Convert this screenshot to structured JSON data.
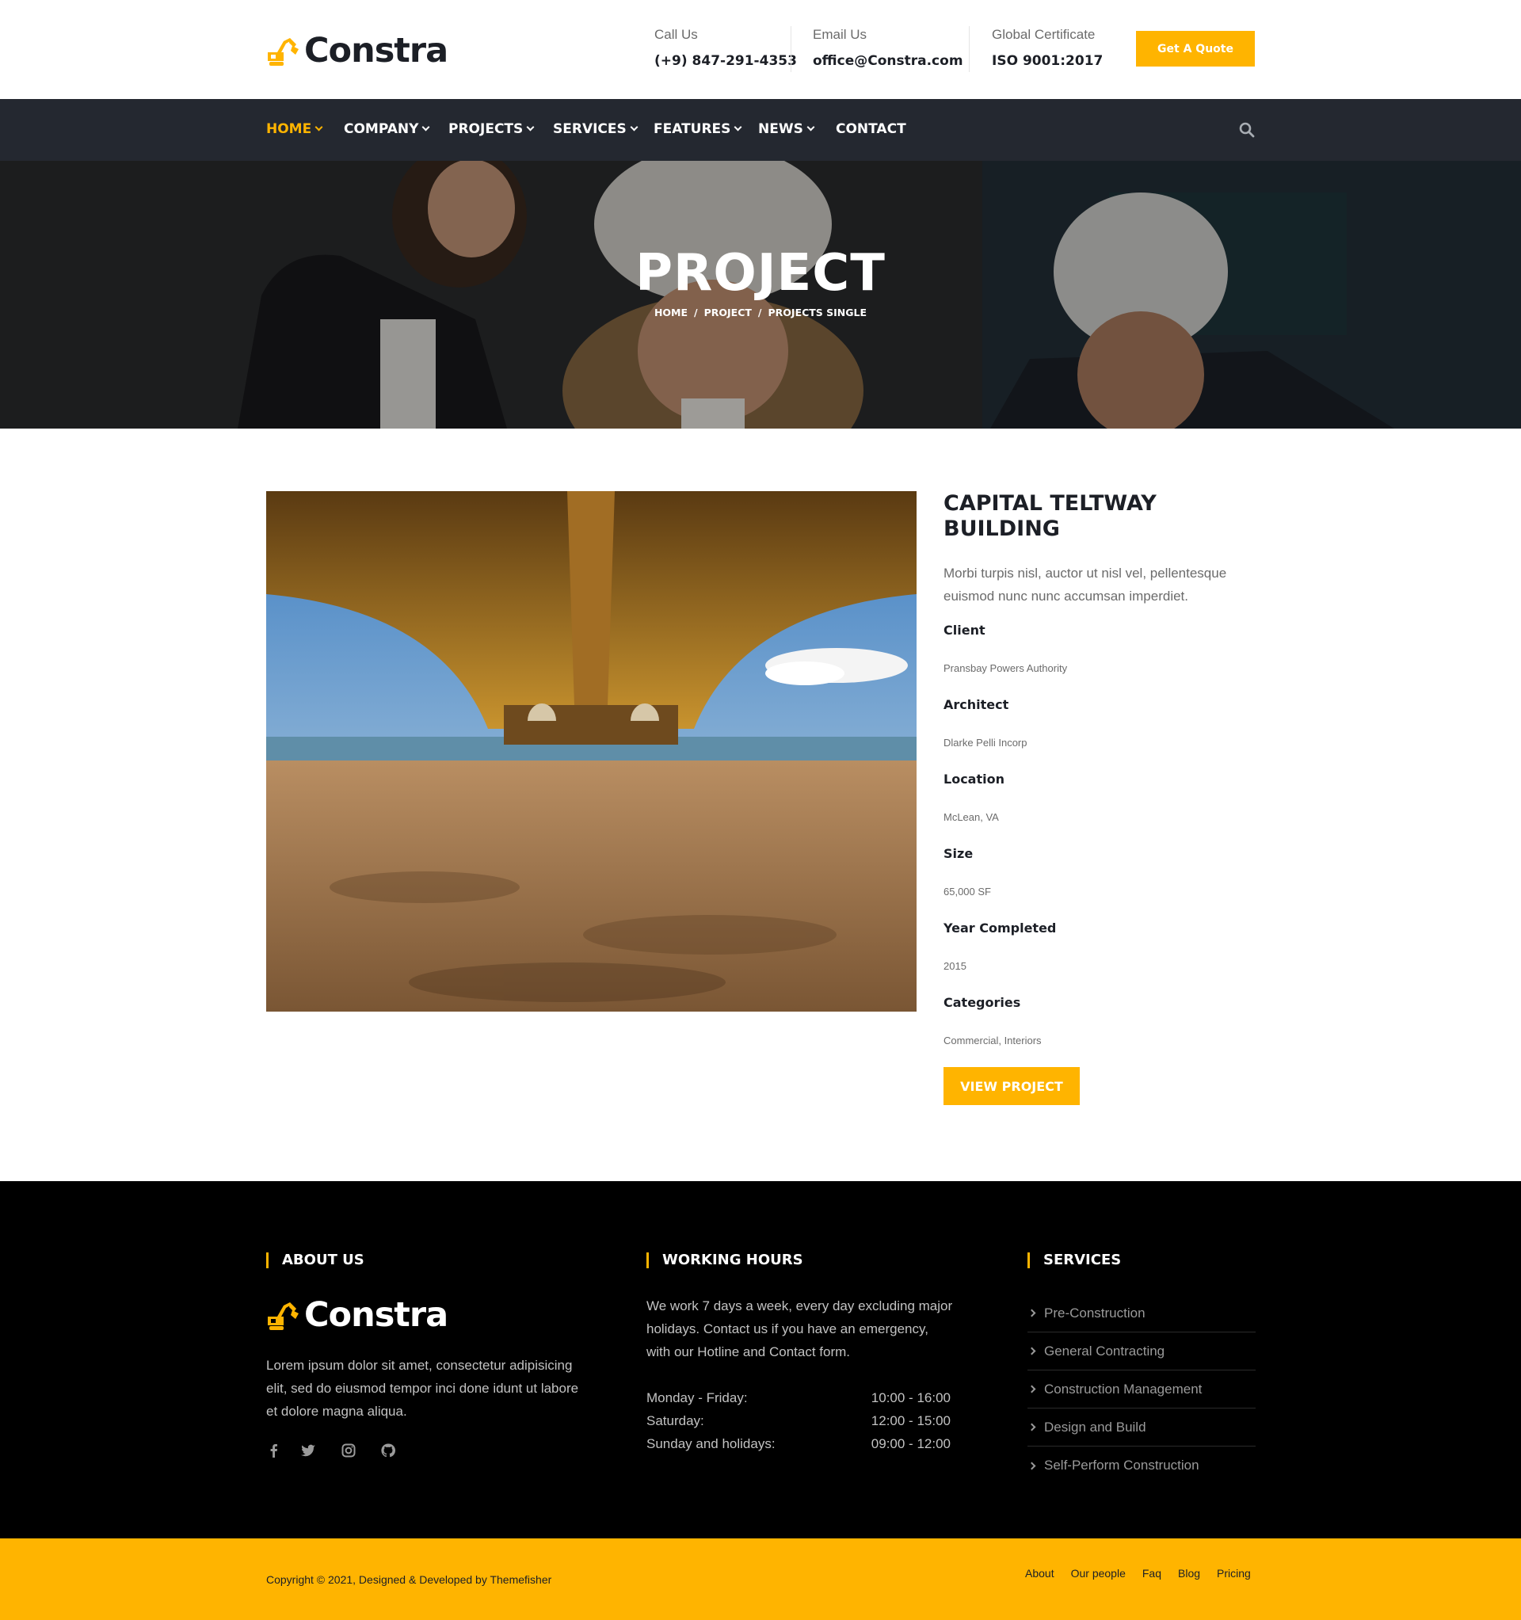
{
  "brand": {
    "name": "Constra",
    "accent": "#ffb400",
    "dark": "#242830"
  },
  "header": {
    "call": {
      "label": "Call Us",
      "value": "(+9) 847-291-4353"
    },
    "email": {
      "label": "Email Us",
      "value": "office@Constra.com"
    },
    "cert": {
      "label": "Global Certificate",
      "value": "ISO 9001:2017"
    },
    "quote_label": "Get A Quote"
  },
  "nav": {
    "items": [
      {
        "label": "HOME"
      },
      {
        "label": "COMPANY"
      },
      {
        "label": "PROJECTS"
      },
      {
        "label": "SERVICES"
      },
      {
        "label": "FEATURES"
      },
      {
        "label": "NEWS"
      },
      {
        "label": "CONTACT"
      }
    ],
    "active": "HOME",
    "search_icon": "search-icon"
  },
  "banner": {
    "title": "PROJECT",
    "breadcrumb": [
      "HOME",
      "PROJECT",
      "PROJECTS SINGLE"
    ],
    "separator": "/"
  },
  "project": {
    "title": "CAPITAL TELTWAY BUILDING",
    "description": "Morbi turpis nisl, auctor ut nisl vel, pellentesque euismod nunc nunc accumsan imperdiet.",
    "meta": [
      {
        "label": "Client",
        "value": "Pransbay Powers Authority"
      },
      {
        "label": "Architect",
        "value": "Dlarke Pelli Incorp"
      },
      {
        "label": "Location",
        "value": "McLean, VA"
      },
      {
        "label": "Size",
        "value": "65,000 SF"
      },
      {
        "label": "Year Completed",
        "value": "2015"
      },
      {
        "label": "Categories",
        "value": "Commercial, Interiors"
      }
    ],
    "button_label": "VIEW PROJECT"
  },
  "footer": {
    "about": {
      "heading": "ABOUT US",
      "text": "Lorem ipsum dolor sit amet, consectetur adipisicing elit, sed do eiusmod tempor inci done idunt ut labore et dolore magna aliqua.",
      "social": [
        "facebook-icon",
        "twitter-icon",
        "instagram-icon",
        "github-icon"
      ]
    },
    "hours": {
      "heading": "WORKING HOURS",
      "text": "We work 7 days a week, every day excluding major holidays. Contact us if you have an emergency, with our Hotline and Contact form.",
      "rows": [
        {
          "day": "Monday - Friday:",
          "time": "10:00 - 16:00"
        },
        {
          "day": "Saturday:",
          "time": "12:00 - 15:00"
        },
        {
          "day": "Sunday and holidays:",
          "time": "09:00 - 12:00"
        }
      ]
    },
    "services": {
      "heading": "SERVICES",
      "items": [
        "Pre-Construction",
        "General Contracting",
        "Construction Management",
        "Design and Build",
        "Self-Perform Construction"
      ]
    }
  },
  "copyright": {
    "text": "Copyright © 2021, Designed & Developed by Themefisher",
    "links": [
      "About",
      "Our people",
      "Faq",
      "Blog",
      "Pricing"
    ]
  }
}
